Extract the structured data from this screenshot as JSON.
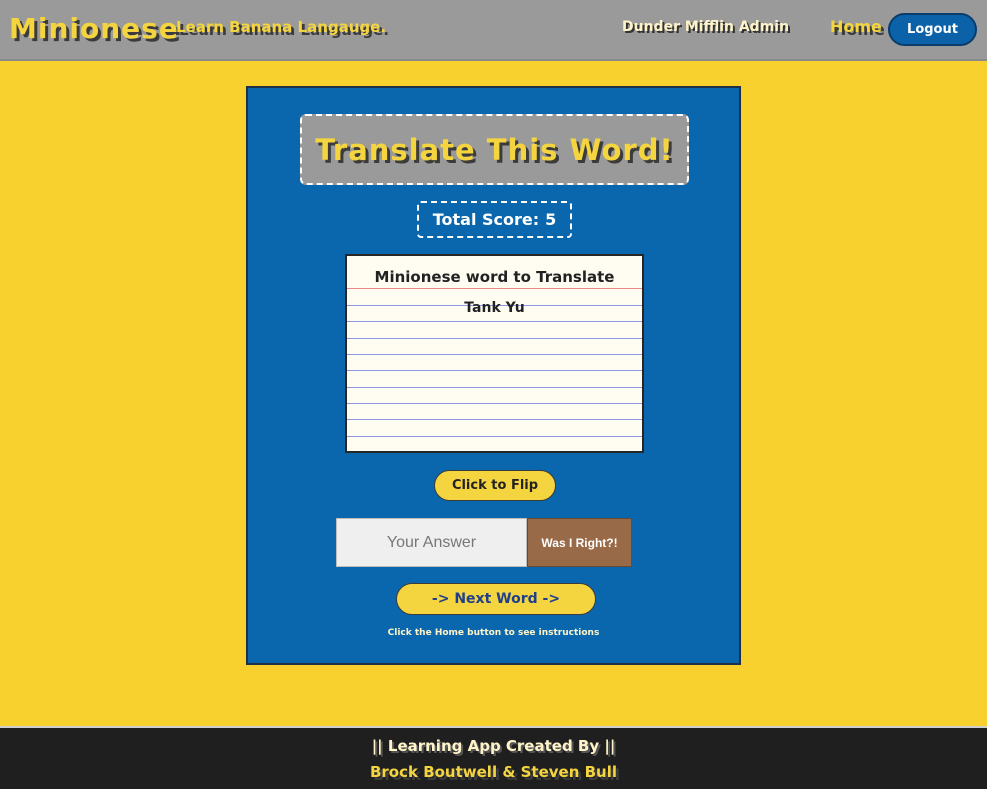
{
  "header": {
    "brand": "Minionese",
    "tagline": "Learn Banana Langauge.",
    "user": "Dunder Mifflin Admin",
    "home_link": "Home",
    "logout_label": "Logout"
  },
  "main": {
    "title": "Translate This Word!",
    "score_label": "Total Score:",
    "score_value": "5",
    "card_label": "Minionese word to Translate",
    "card_word": "Tank Yu",
    "flip_label": "Click to Flip",
    "answer_placeholder": "Your Answer",
    "check_label": "Was I Right?!",
    "next_label": "-> Next Word ->",
    "hint": "Click the Home button to see instructions"
  },
  "footer": {
    "line1": "|| Learning App Created By ||",
    "line2": "Brock Boutwell & Steven Bull"
  }
}
